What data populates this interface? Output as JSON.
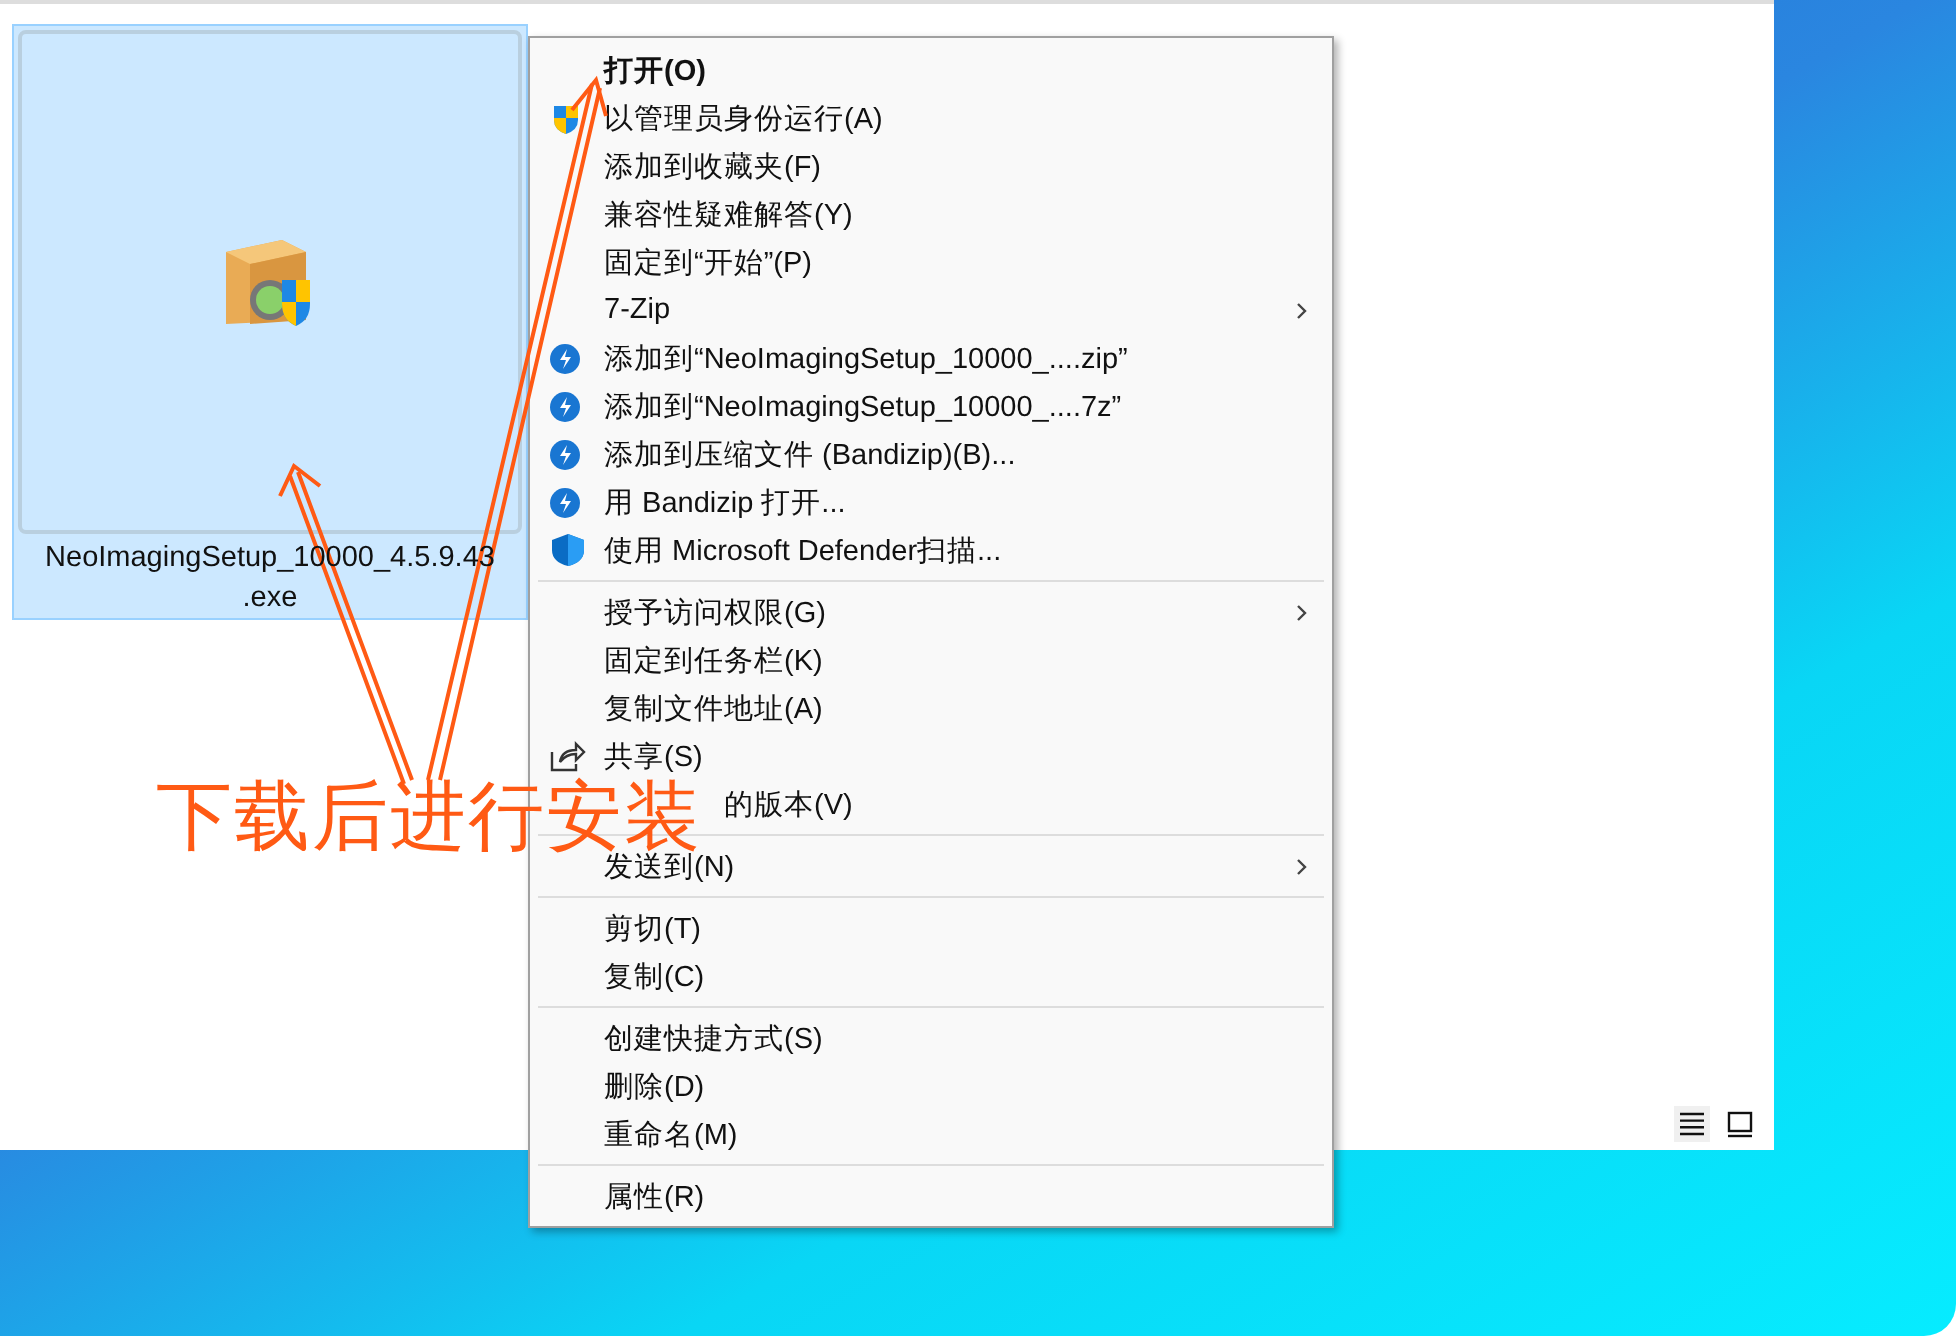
{
  "file": {
    "name_line1": "NeoImagingSetup_10000_4.5.9.43",
    "name_line2": ".exe",
    "selected": true
  },
  "context_menu": {
    "items": [
      {
        "kind": "plain",
        "label": "打开(O)",
        "default": true,
        "submenu": false
      },
      {
        "kind": "shield",
        "label": "以管理员身份运行(A)",
        "default": false,
        "submenu": false
      },
      {
        "kind": "plain",
        "label": "添加到收藏夹(F)",
        "default": false,
        "submenu": false
      },
      {
        "kind": "plain",
        "label": "兼容性疑难解答(Y)",
        "default": false,
        "submenu": false
      },
      {
        "kind": "plain",
        "label": "固定到“开始”(P)",
        "default": false,
        "submenu": false
      },
      {
        "kind": "plain",
        "label": "7-Zip",
        "default": false,
        "submenu": true
      },
      {
        "kind": "bandizip",
        "label": "添加到“NeoImagingSetup_10000_....zip”",
        "default": false,
        "submenu": false
      },
      {
        "kind": "bandizip",
        "label": "添加到“NeoImagingSetup_10000_....7z”",
        "default": false,
        "submenu": false
      },
      {
        "kind": "bandizip",
        "label": "添加到压缩文件 (Bandizip)(B)...",
        "default": false,
        "submenu": false
      },
      {
        "kind": "bandizip",
        "label": "用 Bandizip 打开...",
        "default": false,
        "submenu": false
      },
      {
        "kind": "defender",
        "label": "使用 Microsoft Defender扫描...",
        "default": false,
        "submenu": false
      },
      {
        "kind": "separator"
      },
      {
        "kind": "plain",
        "label": "授予访问权限(G)",
        "default": false,
        "submenu": true
      },
      {
        "kind": "plain",
        "label": "固定到任务栏(K)",
        "default": false,
        "submenu": false
      },
      {
        "kind": "plain",
        "label": "复制文件地址(A)",
        "default": false,
        "submenu": false
      },
      {
        "kind": "share",
        "label": "共享(S)",
        "default": false,
        "submenu": false
      },
      {
        "kind": "partial",
        "label": "的版本(V)"
      },
      {
        "kind": "separator"
      },
      {
        "kind": "plain",
        "label": "发送到(N)",
        "default": false,
        "submenu": true
      },
      {
        "kind": "separator"
      },
      {
        "kind": "plain",
        "label": "剪切(T)",
        "default": false,
        "submenu": false
      },
      {
        "kind": "plain",
        "label": "复制(C)",
        "default": false,
        "submenu": false
      },
      {
        "kind": "separator"
      },
      {
        "kind": "plain",
        "label": "创建快捷方式(S)",
        "default": false,
        "submenu": false
      },
      {
        "kind": "plain",
        "label": "删除(D)",
        "default": false,
        "submenu": false
      },
      {
        "kind": "plain",
        "label": "重命名(M)",
        "default": false,
        "submenu": false
      },
      {
        "kind": "separator"
      },
      {
        "kind": "plain",
        "label": "属性(R)",
        "default": false,
        "submenu": false
      }
    ]
  },
  "annotation": {
    "text": "下载后进行安装"
  }
}
